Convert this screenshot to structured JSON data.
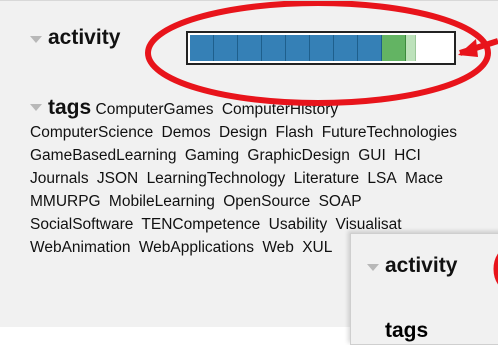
{
  "activity": {
    "label": "activity",
    "segments": [
      {
        "type": "blue"
      },
      {
        "type": "blue"
      },
      {
        "type": "blue"
      },
      {
        "type": "blue"
      },
      {
        "type": "blue"
      },
      {
        "type": "blue"
      },
      {
        "type": "blue"
      },
      {
        "type": "blue"
      },
      {
        "type": "green"
      },
      {
        "type": "light"
      },
      {
        "type": "empty"
      }
    ]
  },
  "tags": {
    "label": "tags",
    "items": [
      "ComputerGames",
      "ComputerHistory",
      "ComputerScience",
      "Demos",
      "Design",
      "Flash",
      "FutureTechnologies",
      "GameBasedLearning",
      "Gaming",
      "GraphicDesign",
      "GUI",
      "HCI",
      "Journals",
      "JSON",
      "LearningTechnology",
      "Literature",
      "LSA",
      "Mace",
      "MMURPG",
      "MobileLearning",
      "OpenSource",
      "SOAP",
      "SocialSoftware",
      "TENCompetence",
      "Usability",
      "Visualisat",
      "WebAnimation",
      "WebApplications",
      "Web",
      "XUL"
    ]
  },
  "overlay": {
    "activity_label": "activity",
    "tags_label": "tags"
  },
  "colors": {
    "callout": "#e8141b",
    "bar_blue": "#3580b6",
    "bar_green": "#63b463"
  }
}
